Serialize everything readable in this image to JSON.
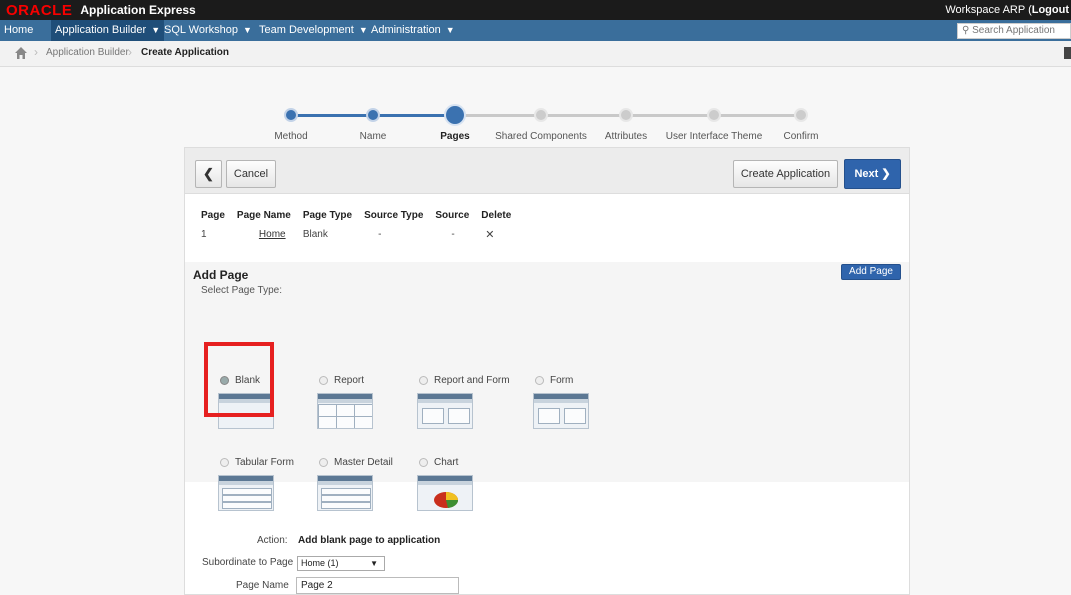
{
  "header": {
    "logo_text": "ORACLE",
    "product": "Application Express",
    "workspace": "Workspace ARP",
    "logout": "Logout"
  },
  "nav": {
    "items": [
      {
        "label": "Home"
      },
      {
        "label": "Application Builder",
        "active": true
      },
      {
        "label": "SQL Workshop"
      },
      {
        "label": "Team Development"
      },
      {
        "label": "Administration"
      }
    ],
    "search_placeholder": "Search Application"
  },
  "breadcrumb": {
    "items": [
      {
        "label": "Application Builder"
      },
      {
        "label": "Create Application"
      }
    ]
  },
  "wizard": {
    "steps": [
      {
        "label": "Method",
        "state": "done"
      },
      {
        "label": "Name",
        "state": "done"
      },
      {
        "label": "Pages",
        "state": "current"
      },
      {
        "label": "Shared Components",
        "state": "todo"
      },
      {
        "label": "Attributes",
        "state": "todo"
      },
      {
        "label": "User Interface Theme",
        "state": "todo"
      },
      {
        "label": "Confirm",
        "state": "todo"
      }
    ],
    "back_glyph": "❮",
    "cancel": "Cancel",
    "create_application": "Create Application",
    "next": "Next",
    "next_glyph": "❯"
  },
  "pages_table": {
    "headers": [
      "Page",
      "Page Name",
      "Page Type",
      "Source Type",
      "Source",
      "Delete"
    ],
    "rows": [
      {
        "page": "1",
        "name": "Home",
        "type": "Blank",
        "source_type": "-",
        "source": "-",
        "delete": "✕"
      }
    ]
  },
  "add_page": {
    "title": "Add Page",
    "subtitle": "Select Page Type:",
    "add_button": "Add Page",
    "types": [
      {
        "label": "Blank",
        "selected": true
      },
      {
        "label": "Report",
        "selected": false
      },
      {
        "label": "Report and Form",
        "selected": false
      },
      {
        "label": "Form",
        "selected": false
      },
      {
        "label": "Tabular Form",
        "selected": false
      },
      {
        "label": "Master Detail",
        "selected": false
      },
      {
        "label": "Chart",
        "selected": false
      }
    ]
  },
  "form": {
    "action_label": "Action:",
    "action_value": "Add blank page to application",
    "subordinate_label": "Subordinate to Page",
    "subordinate_value": "Home (1)",
    "page_name_label": "Page Name",
    "page_name_value": "Page 2"
  },
  "colors": {
    "brand_red": "#f80000",
    "nav_blue": "#3a6e9b",
    "primary_button": "#2f64ac",
    "highlight_box": "#e62020"
  }
}
